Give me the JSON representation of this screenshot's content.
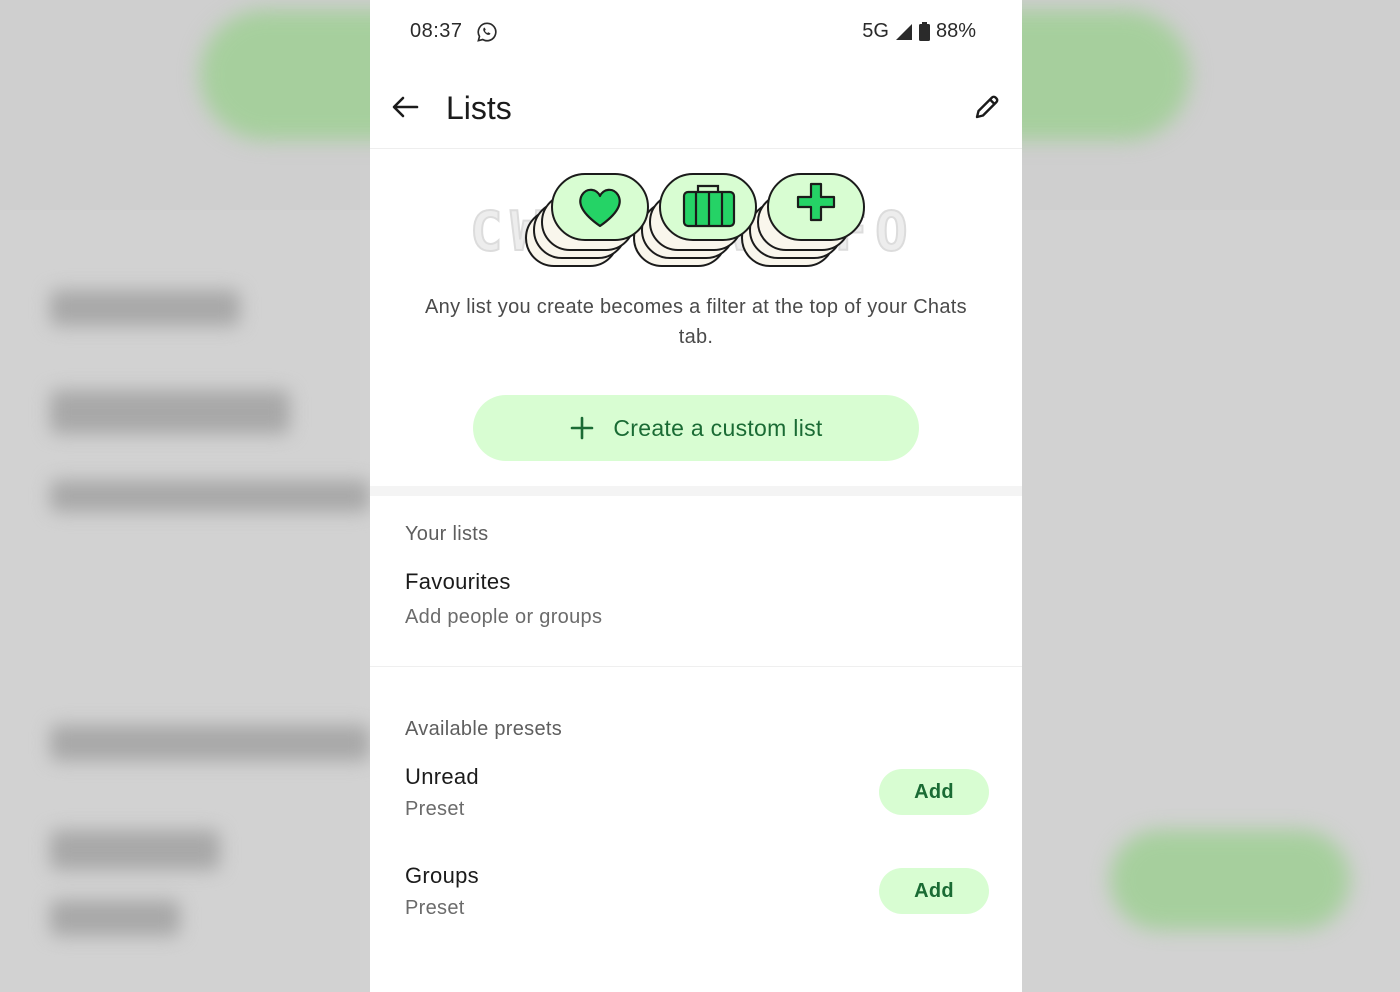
{
  "status_bar": {
    "time": "08:37",
    "network": "5G",
    "battery": "88%",
    "icons": [
      "whatsapp-icon",
      "signal-icon",
      "battery-icon"
    ]
  },
  "app_bar": {
    "title": "Lists",
    "icons": [
      "back-arrow-icon",
      "pencil-icon"
    ]
  },
  "hero": {
    "watermark": "CWABETAINFO",
    "illustration_icons": [
      "heart-icon",
      "briefcase-icon",
      "plus-icon"
    ],
    "description": "Any list you create becomes a filter at the top of your Chats tab.",
    "create_button_label": "Create a custom list"
  },
  "your_lists": {
    "header": "Your lists",
    "items": [
      {
        "title": "Favourites",
        "subtitle": "Add people or groups"
      }
    ]
  },
  "presets": {
    "header": "Available presets",
    "items": [
      {
        "title": "Unread",
        "subtitle": "Preset",
        "action_label": "Add"
      },
      {
        "title": "Groups",
        "subtitle": "Preset",
        "action_label": "Add"
      }
    ]
  },
  "colors": {
    "accent_green": "#1a6b34",
    "button_bg": "#d8fdd2",
    "icon_green": "#25d366"
  }
}
